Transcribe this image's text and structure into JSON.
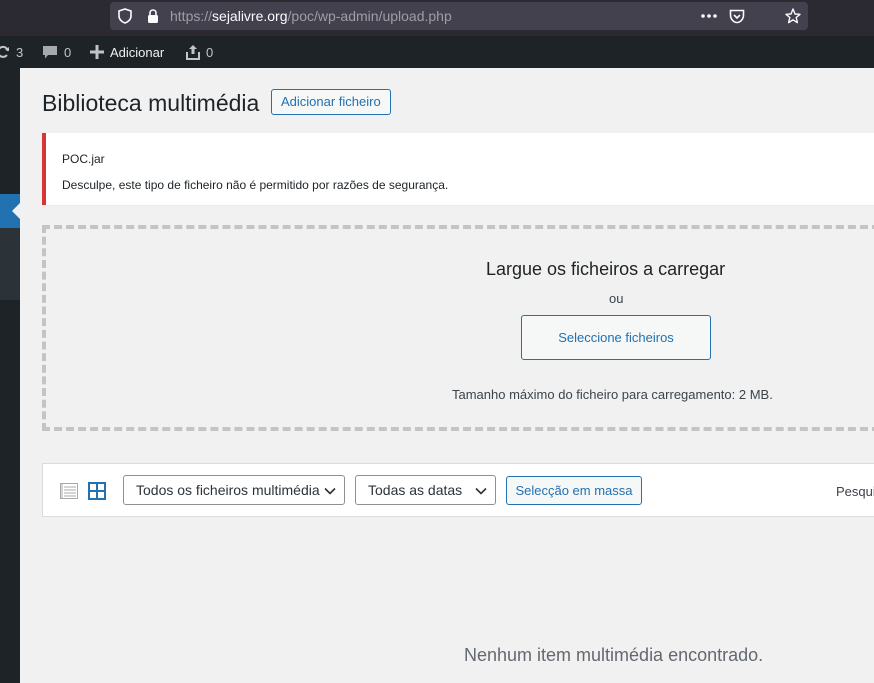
{
  "browser": {
    "url_prefix": "https://",
    "url_host": "sejalivre.org",
    "url_path": "/poc/wp-admin/upload.php",
    "icons": [
      "shield-icon",
      "lock-icon",
      "more-icon",
      "pocket-icon",
      "bookmark-star-icon"
    ]
  },
  "admin_bar": {
    "updates_count": "3",
    "comments_count": "0",
    "add_new_label": "Adicionar",
    "uploads_count": "0"
  },
  "page": {
    "title": "Biblioteca multimédia",
    "add_file_label": "Adicionar ficheiro"
  },
  "notice": {
    "filename": "POC.jar",
    "message": "Desculpe, este tipo de ficheiro não é permitido por razões de segurança.",
    "accent_color": "#d63638"
  },
  "uploader": {
    "drop_title": "Largue os ficheiros a carregar",
    "or_label": "ou",
    "select_files_label": "Seleccione ficheiros",
    "max_size_text": "Tamanho máximo do ficheiro para carregamento: 2 MB."
  },
  "toolbar": {
    "type_filter": "Todos os ficheiros multimédia",
    "date_filter": "Todas as datas",
    "bulk_select_label": "Selecção em massa",
    "search_label": "Pesqui"
  },
  "empty_message": "Nenhum item multimédia encontrado.",
  "colors": {
    "accent": "#2271b1",
    "admin_bar": "#1d2327",
    "background": "#f1f1f1"
  }
}
